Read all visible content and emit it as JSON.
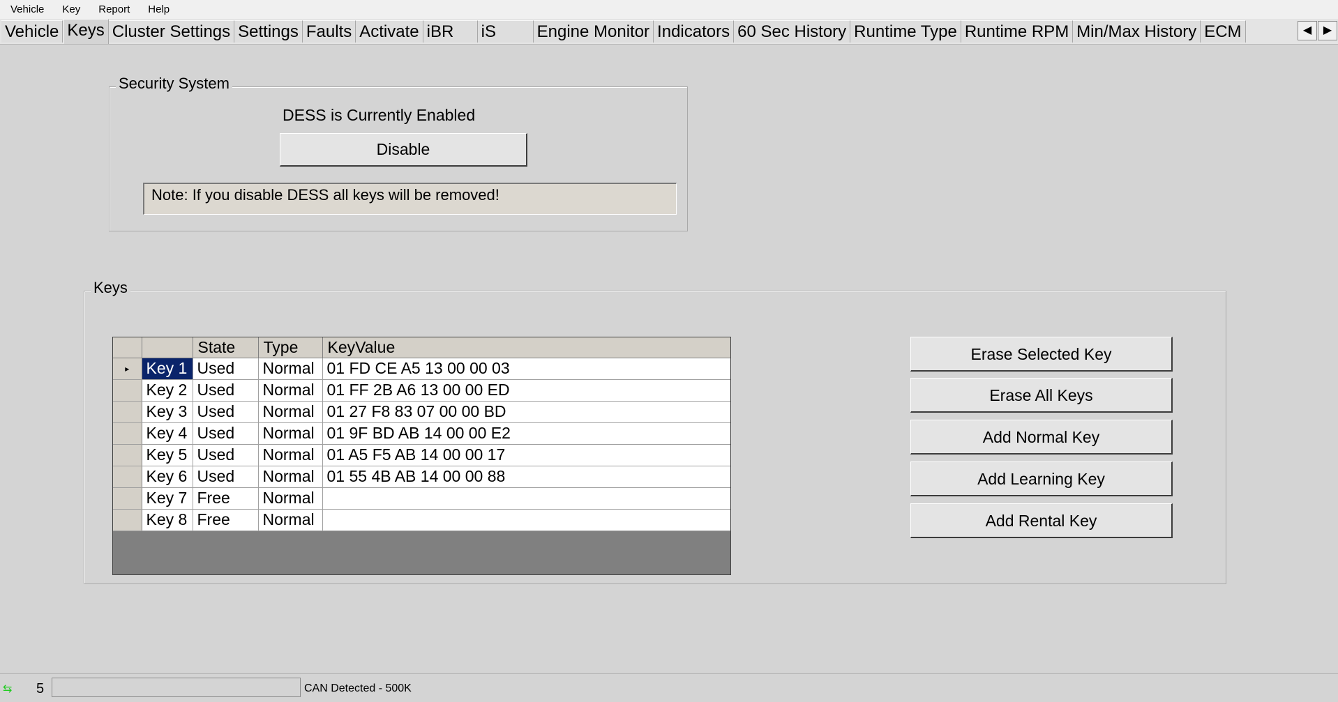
{
  "menu": [
    "Vehicle",
    "Key",
    "Report",
    "Help"
  ],
  "tabs": [
    {
      "label": "Vehicle",
      "active": false
    },
    {
      "label": "Keys",
      "active": true
    },
    {
      "label": "Cluster Settings",
      "active": false
    },
    {
      "label": "Settings",
      "active": false
    },
    {
      "label": "Faults",
      "active": false
    },
    {
      "label": "Activate",
      "active": false
    },
    {
      "label": "iBR",
      "active": false
    },
    {
      "label": "iS",
      "active": false
    },
    {
      "label": "Engine Monitor",
      "active": false
    },
    {
      "label": "Indicators",
      "active": false
    },
    {
      "label": "60 Sec History",
      "active": false
    },
    {
      "label": "Runtime Type",
      "active": false
    },
    {
      "label": "Runtime RPM",
      "active": false
    },
    {
      "label": "Min/Max History",
      "active": false
    },
    {
      "label": "ECM",
      "active": false
    }
  ],
  "tab_scroll": {
    "left": "◀",
    "right": "▶"
  },
  "security": {
    "title": "Security System",
    "status": "DESS is Currently Enabled",
    "disable_label": "Disable",
    "note": "Note: If you disable DESS all keys will be removed!"
  },
  "keys": {
    "title": "Keys",
    "columns": [
      "",
      "State",
      "Type",
      "KeyValue"
    ],
    "rows": [
      {
        "name": "Key 1",
        "state": "Used",
        "type": "Normal",
        "value": "01 FD CE A5 13 00 00 03",
        "selected": true
      },
      {
        "name": "Key 2",
        "state": "Used",
        "type": "Normal",
        "value": "01 FF 2B A6 13 00 00 ED",
        "selected": false
      },
      {
        "name": "Key 3",
        "state": "Used",
        "type": "Normal",
        "value": "01 27 F8 83 07 00 00 BD",
        "selected": false
      },
      {
        "name": "Key 4",
        "state": "Used",
        "type": "Normal",
        "value": "01 9F BD AB 14 00 00 E2",
        "selected": false
      },
      {
        "name": "Key 5",
        "state": "Used",
        "type": "Normal",
        "value": "01 A5 F5 AB 14 00 00 17",
        "selected": false
      },
      {
        "name": "Key 6",
        "state": "Used",
        "type": "Normal",
        "value": "01 55 4B AB 14 00 00 88",
        "selected": false
      },
      {
        "name": "Key 7",
        "state": "Free",
        "type": "Normal",
        "value": "",
        "selected": false
      },
      {
        "name": "Key 8",
        "state": "Free",
        "type": "Normal",
        "value": "",
        "selected": false
      }
    ],
    "buttons": {
      "erase_selected": "Erase Selected  Key",
      "erase_all": "Erase All Keys",
      "add_normal": "Add Normal Key",
      "add_learning": "Add Learning Key",
      "add_rental": "Add Rental Key"
    }
  },
  "status": {
    "count": "5",
    "connection": "CAN Detected - 500K"
  },
  "colors": {
    "background": "#d4d4d4",
    "selection": "#0a246a",
    "grid_empty": "#808080",
    "activity_icon": "#22cc22"
  }
}
